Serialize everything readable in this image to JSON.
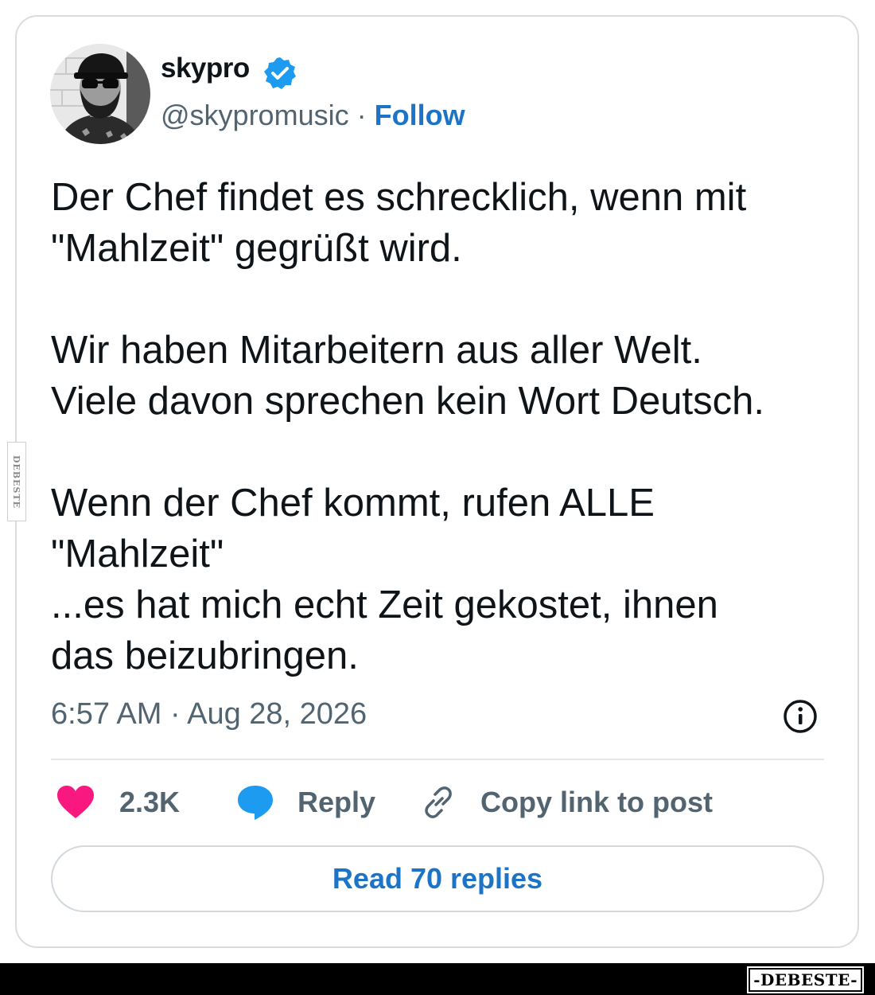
{
  "post": {
    "author": {
      "display_name": "skypro",
      "handle": "@skypromusic",
      "separator": "·",
      "follow_label": "Follow",
      "verified_icon": "verified-badge-icon",
      "avatar_icon": "profile-photo"
    },
    "text": {
      "paragraph_1": "Der Chef findet es schrecklich, wenn mit\n\"Mahlzeit\" gegrüßt wird.",
      "paragraph_2": "Wir haben Mitarbeitern aus aller Welt.\nViele davon sprechen kein Wort Deutsch.",
      "paragraph_3": "Wenn der Chef kommt, rufen ALLE\n\"Mahlzeit\"\n...es hat mich echt Zeit gekostet, ihnen\ndas beizubringen."
    },
    "timestamp": "6:57 AM · Aug 28, 2026",
    "actions": {
      "like_count": "2.3K",
      "reply_label": "Reply",
      "copy_link_label": "Copy link to post"
    },
    "read_replies_label": "Read 70 replies"
  },
  "watermark": {
    "side_text": "DEBESTE",
    "bottom_logo": "-DEBESTE-"
  },
  "colors": {
    "verified_blue": "#1d9bf0",
    "link_blue": "#1d74c7",
    "heart_pink": "#f91880",
    "reply_blue": "#1d9bf0",
    "secondary_text": "#536471",
    "primary_text": "#0f1419"
  }
}
